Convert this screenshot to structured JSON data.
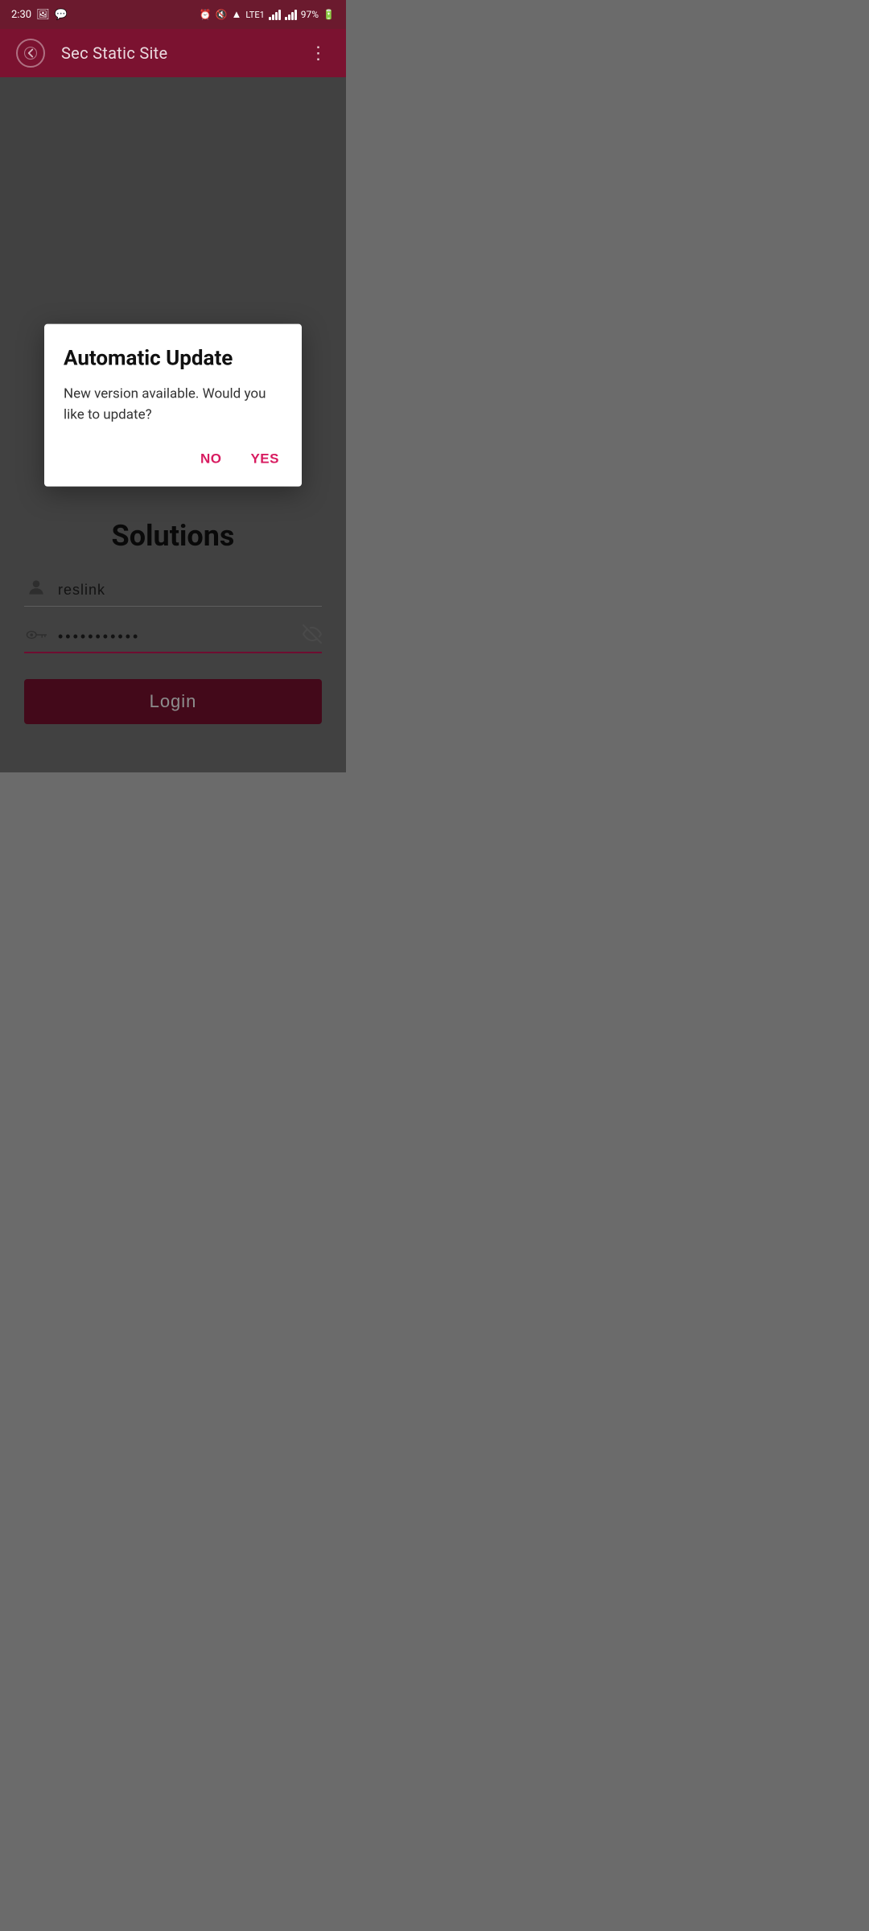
{
  "statusBar": {
    "time": "2:30",
    "battery": "97%",
    "icons": {
      "alarm": "⏰",
      "mute": "🔇",
      "wifi": "wifi-icon",
      "lte": "LTE1",
      "battery_icon": "🔋"
    }
  },
  "appBar": {
    "title": "Sec Static Site",
    "backLabel": "←",
    "moreLabel": "⋮"
  },
  "loginPage": {
    "solutionsTitle": "Solutions",
    "usernamePlaceholder": "reslink",
    "passwordDots": "·········",
    "loginButtonLabel": "Login"
  },
  "dialog": {
    "title": "Automatic Update",
    "message": "New version available. Would you like to update?",
    "noLabel": "NO",
    "yesLabel": "YES"
  },
  "colors": {
    "brand": "#7b1230",
    "accent": "#d81b60",
    "overlayBg": "rgba(0,0,0,0.45)",
    "dialogBg": "#ffffff"
  }
}
